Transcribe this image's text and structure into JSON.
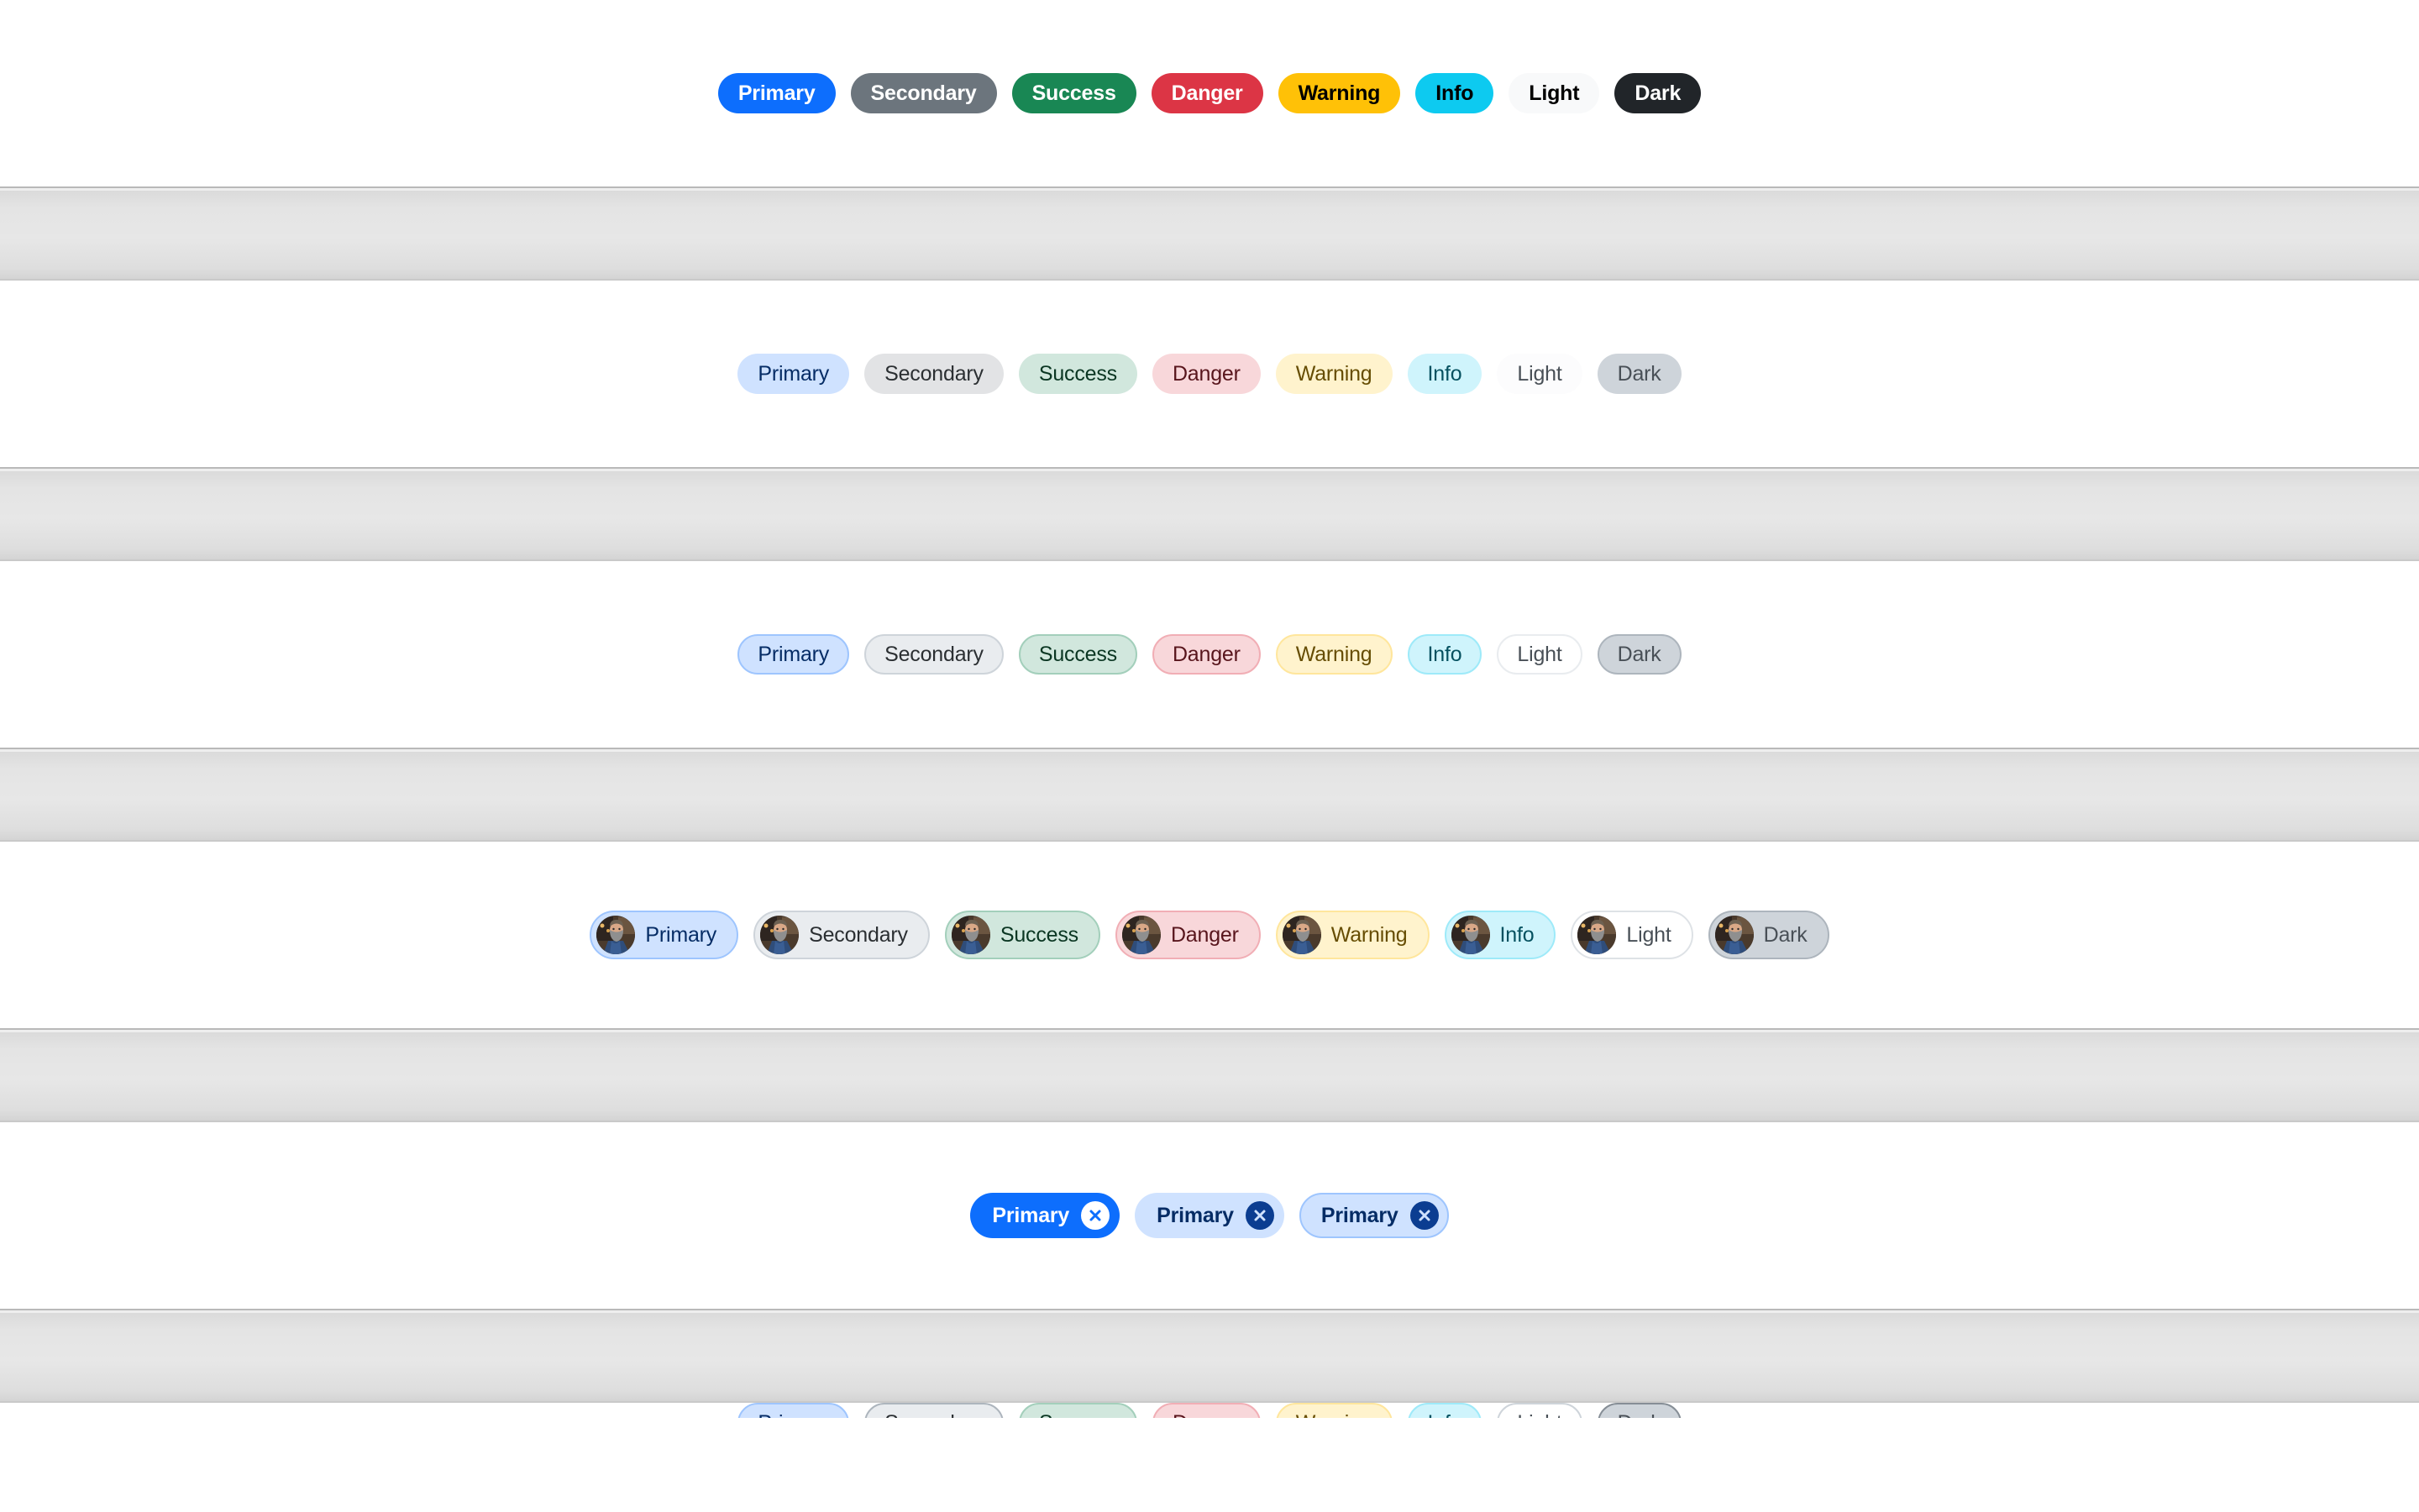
{
  "colors": {
    "primary": "#0d6efd",
    "secondary": "#6c757d",
    "success": "#198754",
    "danger": "#dc3545",
    "warning": "#ffc107",
    "info": "#0dcaf0",
    "light": "#f8f9fa",
    "dark": "#212529",
    "band": "#e4e4e4",
    "page_background": "#ffffff"
  },
  "sections": [
    {
      "name": "solid-chips",
      "chips": [
        {
          "label": "Primary",
          "variant": "primary"
        },
        {
          "label": "Secondary",
          "variant": "secondary"
        },
        {
          "label": "Success",
          "variant": "success"
        },
        {
          "label": "Danger",
          "variant": "danger"
        },
        {
          "label": "Warning",
          "variant": "warning"
        },
        {
          "label": "Info",
          "variant": "info"
        },
        {
          "label": "Light",
          "variant": "light"
        },
        {
          "label": "Dark",
          "variant": "dark"
        }
      ]
    },
    {
      "name": "soft-chips",
      "chips": [
        {
          "label": "Primary",
          "variant": "primary"
        },
        {
          "label": "Secondary",
          "variant": "secondary"
        },
        {
          "label": "Success",
          "variant": "success"
        },
        {
          "label": "Danger",
          "variant": "danger"
        },
        {
          "label": "Warning",
          "variant": "warning"
        },
        {
          "label": "Info",
          "variant": "info"
        },
        {
          "label": "Light",
          "variant": "light"
        },
        {
          "label": "Dark",
          "variant": "dark"
        }
      ]
    },
    {
      "name": "outlined-chips",
      "chips": [
        {
          "label": "Primary",
          "variant": "primary"
        },
        {
          "label": "Secondary",
          "variant": "secondary"
        },
        {
          "label": "Success",
          "variant": "success"
        },
        {
          "label": "Danger",
          "variant": "danger"
        },
        {
          "label": "Warning",
          "variant": "warning"
        },
        {
          "label": "Info",
          "variant": "info"
        },
        {
          "label": "Light",
          "variant": "light"
        },
        {
          "label": "Dark",
          "variant": "dark"
        }
      ]
    },
    {
      "name": "avatar-chips",
      "chips": [
        {
          "label": "Primary",
          "variant": "primary",
          "avatar": "user-avatar"
        },
        {
          "label": "Secondary",
          "variant": "secondary",
          "avatar": "user-avatar"
        },
        {
          "label": "Success",
          "variant": "success",
          "avatar": "user-avatar"
        },
        {
          "label": "Danger",
          "variant": "danger",
          "avatar": "user-avatar"
        },
        {
          "label": "Warning",
          "variant": "warning",
          "avatar": "user-avatar"
        },
        {
          "label": "Info",
          "variant": "info",
          "avatar": "user-avatar"
        },
        {
          "label": "Light",
          "variant": "light",
          "avatar": "user-avatar"
        },
        {
          "label": "Dark",
          "variant": "dark",
          "avatar": "user-avatar"
        }
      ]
    },
    {
      "name": "closable-chips",
      "chips": [
        {
          "label": "Primary",
          "style": "filled",
          "close_icon": "close-circle-icon"
        },
        {
          "label": "Primary",
          "style": "soft",
          "close_icon": "close-circle-icon"
        },
        {
          "label": "Primary",
          "style": "outline",
          "close_icon": "close-circle-icon"
        }
      ]
    },
    {
      "name": "clipped-chips",
      "chips": [
        {
          "label": "Primary",
          "variant": "primary"
        },
        {
          "label": "Secondary",
          "variant": "secondary"
        },
        {
          "label": "Success",
          "variant": "success"
        },
        {
          "label": "Danger",
          "variant": "danger"
        },
        {
          "label": "Warning",
          "variant": "warning"
        },
        {
          "label": "Info",
          "variant": "info"
        },
        {
          "label": "Light",
          "variant": "light"
        },
        {
          "label": "Dark",
          "variant": "dark"
        }
      ]
    }
  ]
}
